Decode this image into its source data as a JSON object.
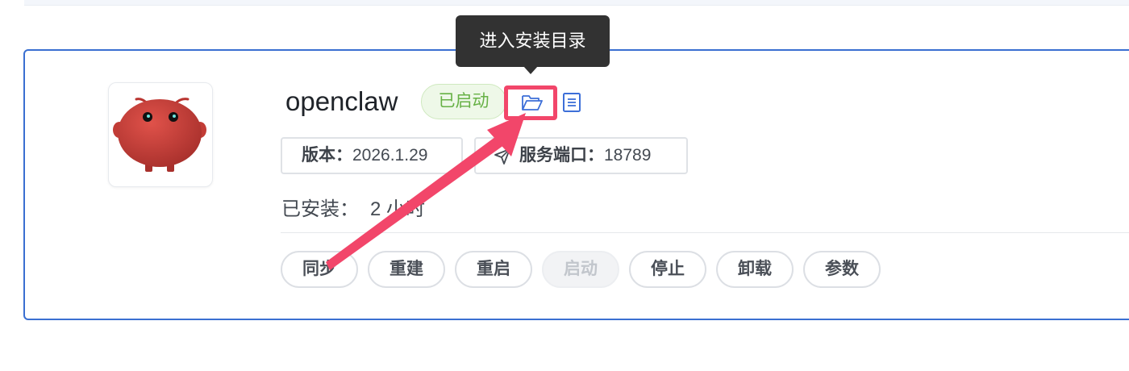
{
  "tooltip": {
    "text": "进入安装目录"
  },
  "app": {
    "name": "openclaw",
    "status": "已启动",
    "icon": "red-pig-mascot",
    "version_label": "版本：",
    "version_value": "2026.1.29",
    "port_label": "服务端口：",
    "port_value": "18789",
    "installed_label": "已安装：",
    "installed_value": "2 小时"
  },
  "icons": {
    "folder": "folder-open-icon",
    "doc": "document-icon",
    "port": "send-arrow-icon"
  },
  "actions": [
    {
      "label": "同步",
      "disabled": false
    },
    {
      "label": "重建",
      "disabled": false
    },
    {
      "label": "重启",
      "disabled": false
    },
    {
      "label": "启动",
      "disabled": true
    },
    {
      "label": "停止",
      "disabled": false
    },
    {
      "label": "卸载",
      "disabled": false
    },
    {
      "label": "参数",
      "disabled": false
    }
  ],
  "colors": {
    "card_border": "#3a6fd1",
    "status_text": "#67b146",
    "status_bg": "#eef8e8",
    "highlight": "#f2466a",
    "tooltip_bg": "#323232",
    "icon_blue": "#3d6fd8"
  }
}
